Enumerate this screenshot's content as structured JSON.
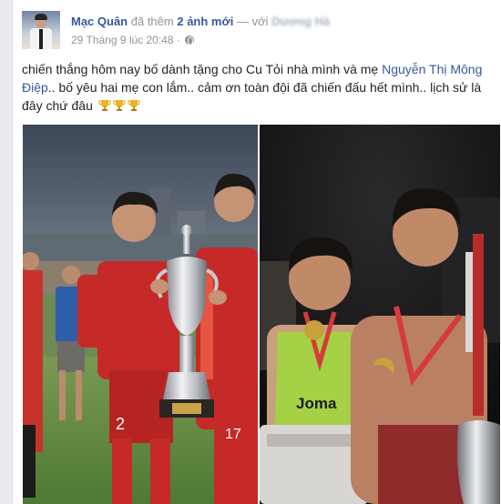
{
  "post": {
    "author": "Mạc Quân",
    "action_text": "đã thêm",
    "photo_count_text": "2 ảnh mới",
    "with_text": "— với",
    "tagged_friend": "Dương Hà",
    "timestamp": "29 Tháng 9 lúc 20:48",
    "separator": "·",
    "privacy_icon": "globe-icon",
    "caption_part1": "chiến thắng hôm nay bố dành tặng cho Cu Tỏi nhà mình và mẹ",
    "caption_link": "Nguyễn Thị Mông Điệp",
    "caption_part2": ".. bố yêu hai mẹ con lắm.. cảm ơn toàn đội đã chiến đấu hết mình.. lịch sử là đây chứ đâu",
    "caption_emojis": [
      "trophy-icon",
      "trophy-icon",
      "trophy-icon"
    ]
  },
  "photos": {
    "left": {
      "alt": "photo-trophy-on-pitch",
      "jersey_numbers": [
        "2",
        "17"
      ]
    },
    "right": {
      "alt": "photo-locker-room-medals",
      "shirt_text": "Joma"
    }
  },
  "colors": {
    "link": "#365899",
    "muted": "#90949c",
    "text": "#1d2129",
    "background": "#e9ebee"
  }
}
